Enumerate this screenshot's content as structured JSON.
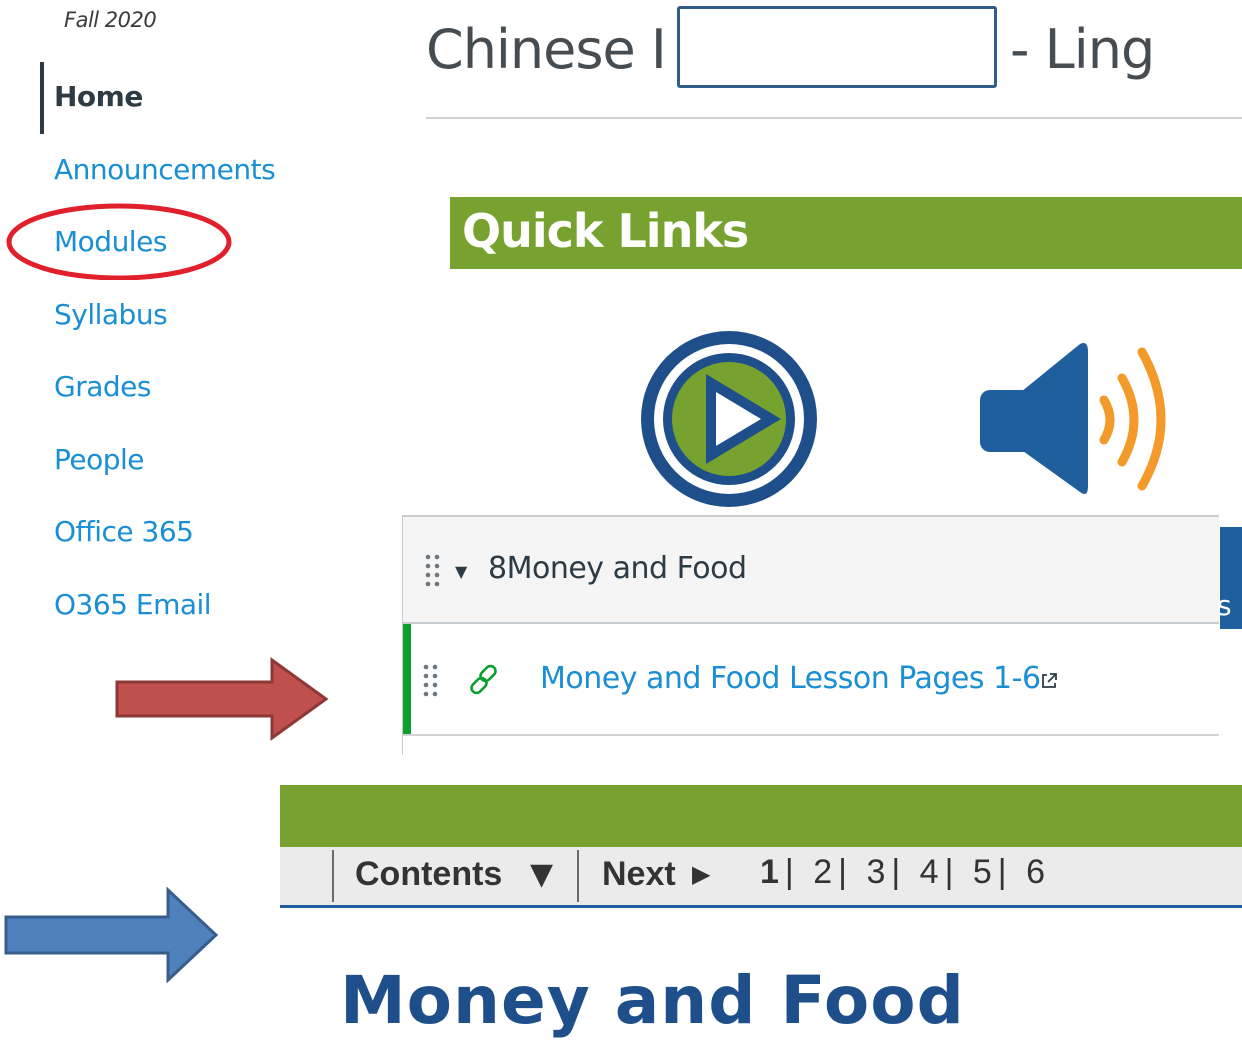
{
  "sidebar": {
    "term": "Fall 2020",
    "items": [
      {
        "label": "Home",
        "active": true
      },
      {
        "label": "Announcements"
      },
      {
        "label": "Modules"
      },
      {
        "label": "Syllabus"
      },
      {
        "label": "Grades"
      },
      {
        "label": "People"
      },
      {
        "label": "Office 365"
      },
      {
        "label": "O365 Email"
      }
    ]
  },
  "header": {
    "title_prefix": "Chinese I",
    "title_suffix": "- Ling"
  },
  "quick_links": {
    "title": "Quick Links",
    "icons": [
      "play-icon",
      "speaker-icon"
    ]
  },
  "module": {
    "name": "8Money and Food",
    "items": [
      {
        "label": "Money and Food Lesson Pages 1-6",
        "icon": "link-icon",
        "external": true
      }
    ],
    "side_tab_letter": "s"
  },
  "lesson_nav": {
    "contents_label": "Contents",
    "contents_arrow": "▼",
    "next_label": "Next",
    "next_arrow": "▶",
    "pages": [
      "1",
      "2",
      "3",
      "4",
      "5",
      "6"
    ],
    "separator": "|",
    "current_page": "1"
  },
  "page": {
    "title": "Money and Food"
  },
  "colors": {
    "link": "#1a8fd4",
    "green": "#78a22f",
    "navy": "#1f4f8a",
    "module_accent": "#0b9f2d",
    "speaker_blue": "#1f5f9e",
    "sound_orange": "#f39a2b",
    "highlight_red": "#e0202a",
    "arrow_red": "#c0504d",
    "arrow_blue": "#4f81bd"
  }
}
